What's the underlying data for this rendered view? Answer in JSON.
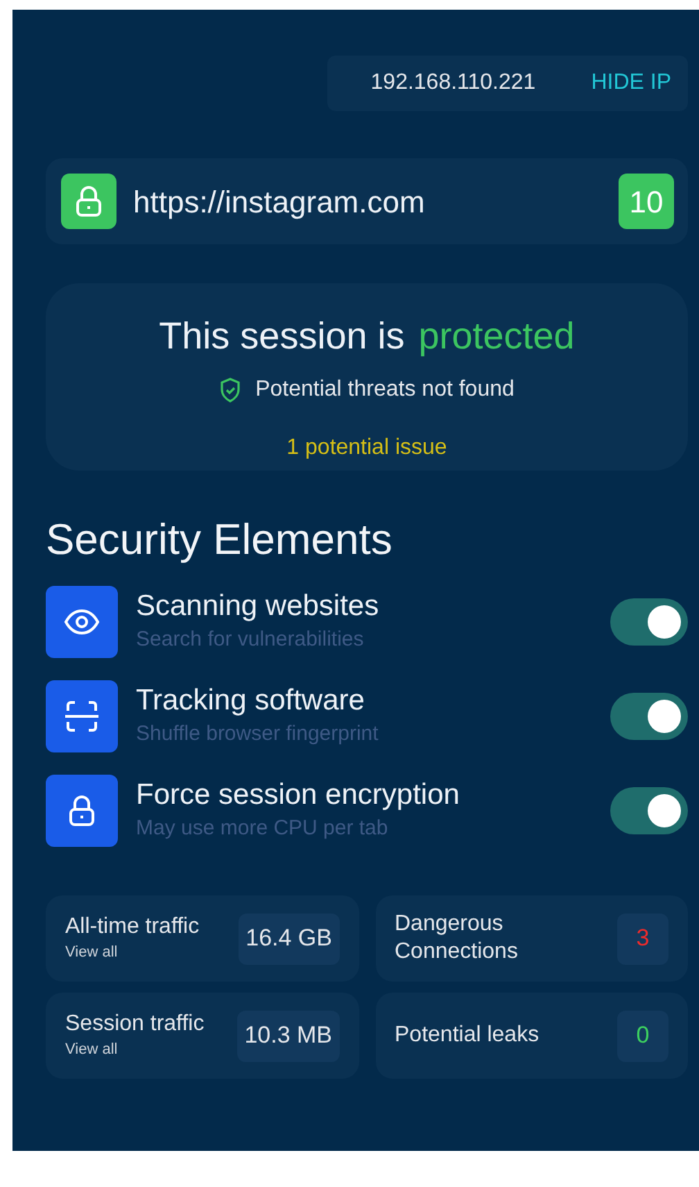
{
  "ip_bar": {
    "ip": "192.168.110.221",
    "action": "HIDE IP"
  },
  "site": {
    "url": "https://instagram.com",
    "score": "10"
  },
  "session": {
    "title": "This session is",
    "status": "protected",
    "threats": "Potential threats not found",
    "issues": "1 potential issue"
  },
  "security": {
    "title": "Security Elements",
    "items": [
      {
        "kind": "eye",
        "title": "Scanning websites",
        "subtitle": "Search for vulnerabilities",
        "on": true
      },
      {
        "kind": "scan",
        "title": "Tracking software",
        "subtitle": "Shuffle browser fingerprint",
        "on": true
      },
      {
        "kind": "lock",
        "title": "Force session encryption",
        "subtitle": "May use more CPU per tab",
        "on": true
      }
    ]
  },
  "stats": [
    {
      "label": "All-time traffic",
      "link": "View all",
      "value": "16.4 GB",
      "color": "#e5e7eb"
    },
    {
      "label": "Dangerous Connections",
      "value": "3",
      "color": "#ef2b2b"
    },
    {
      "label": "Session traffic",
      "link": "View all",
      "value": "10.3 MB",
      "color": "#e5e7eb"
    },
    {
      "label": "Potential leaks",
      "value": "0",
      "color": "#3dd05f"
    }
  ]
}
